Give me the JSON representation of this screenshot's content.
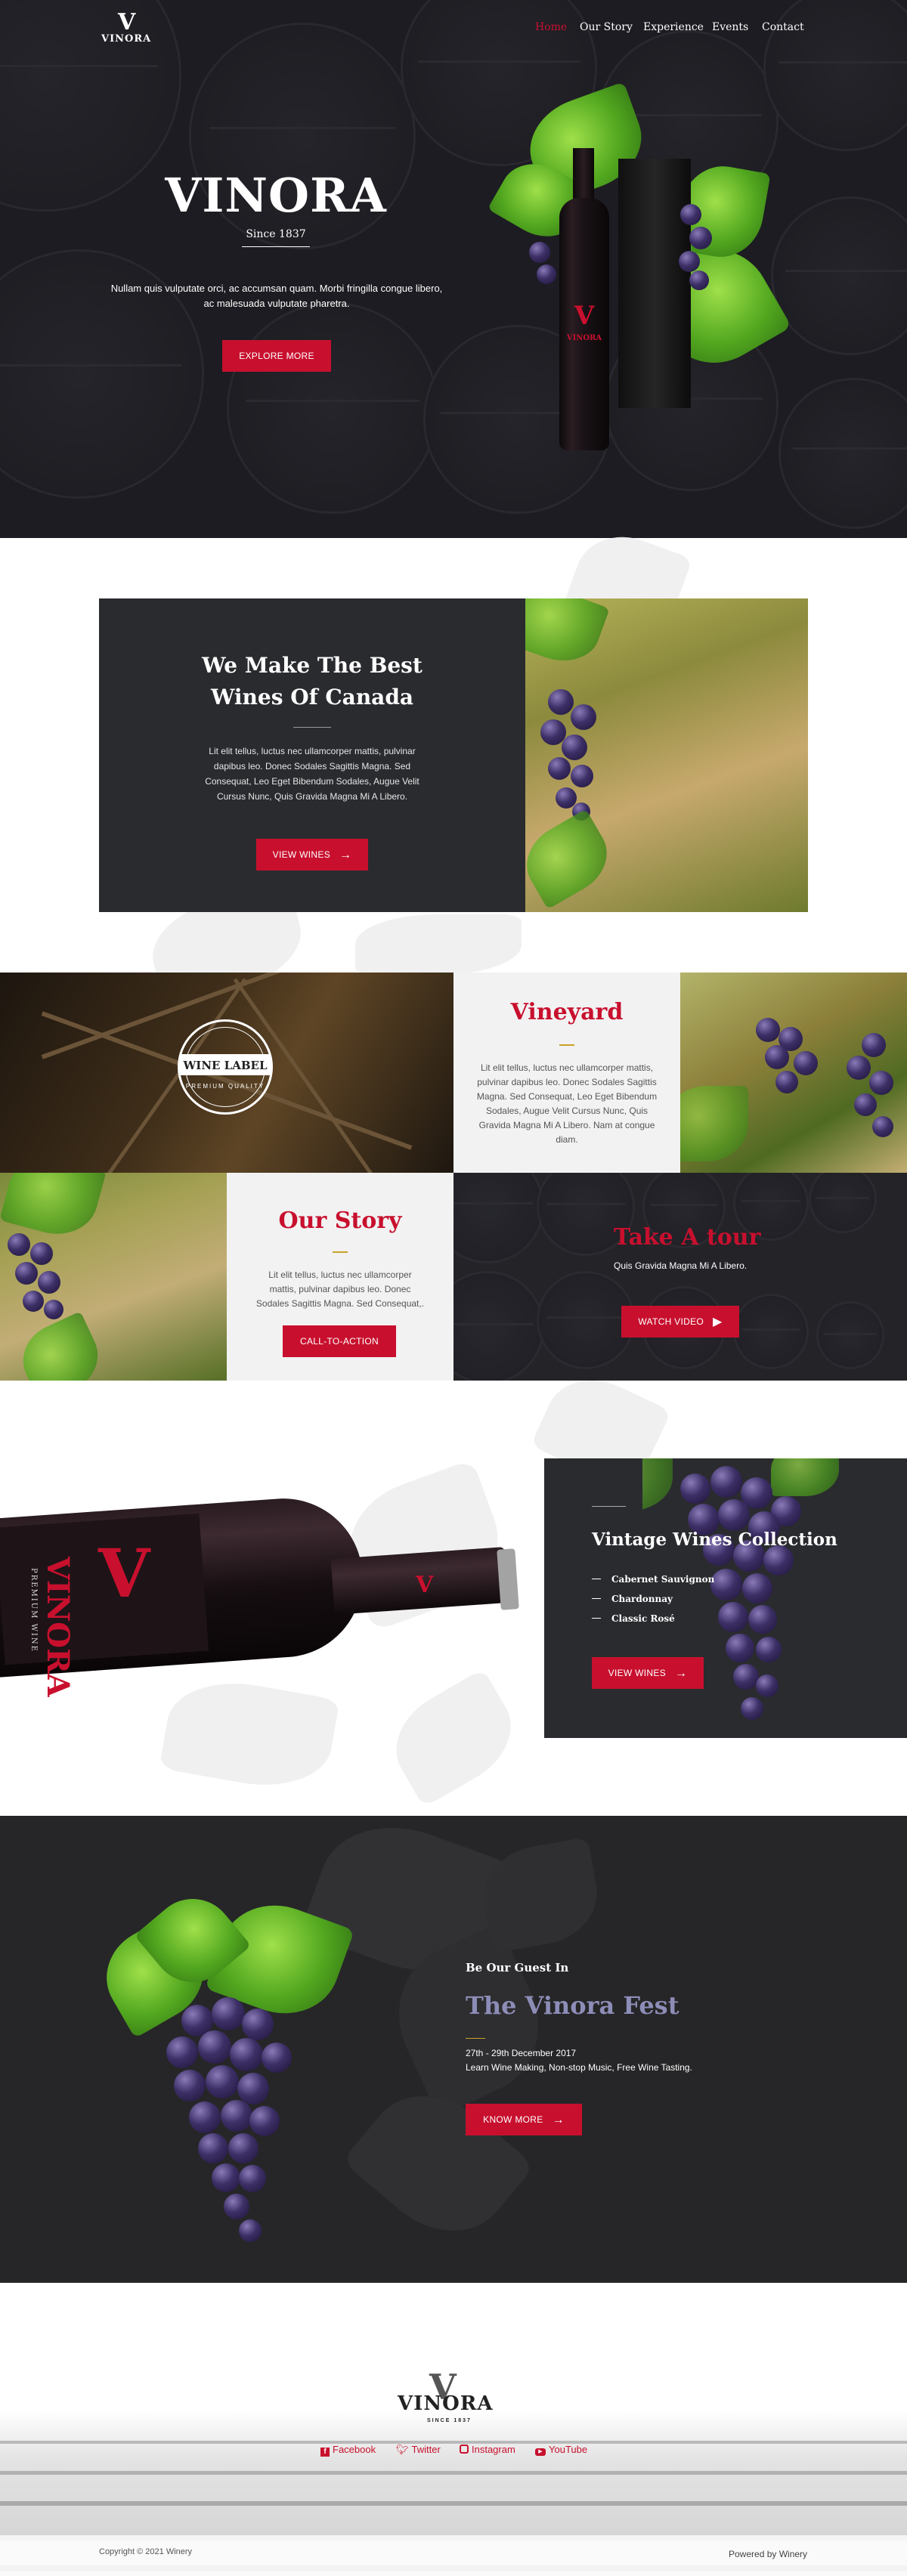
{
  "nav": {
    "logo_mark": "V",
    "logo_text": "VINORA",
    "items": [
      "Home",
      "Our Story",
      "Experience",
      "Events",
      "Contact"
    ]
  },
  "hero": {
    "title": "VINORA",
    "since": "Since 1837",
    "text": "Nullam quis vulputate orci, ac accumsan quam. Morbi fringilla congue libero, ac malesuada vulputate pharetra.",
    "button": "EXPLORE MORE"
  },
  "bottle_label": {
    "mark": "V",
    "name": "VINORA"
  },
  "intro": {
    "heading_line1": "We Make The Best",
    "heading_line2": "Wines Of Canada",
    "text": "Lit elit tellus, luctus nec ullamcorper mattis, pulvinar dapibus leo. Donec Sodales Sagittis Magna. Sed Consequat, Leo Eget Bibendum Sodales, Augue Velit Cursus Nunc, Quis Gravida Magna Mi A Libero.",
    "button": "VIEW WINES"
  },
  "wine_label_badge": {
    "text": "WINE LABEL",
    "sub": "PREMIUM QUALITY"
  },
  "vineyard": {
    "heading": "Vineyard",
    "text": "Lit elit tellus, luctus nec ullamcorper mattis, pulvinar dapibus leo. Donec Sodales Sagittis Magna. Sed Consequat, Leo Eget Bibendum Sodales, Augue Velit Cursus Nunc, Quis Gravida Magna Mi A Libero. Nam at congue diam."
  },
  "our_story": {
    "heading": "Our Story",
    "text": "Lit elit tellus, luctus nec ullamcorper mattis, pulvinar dapibus leo. Donec Sodales Sagittis Magna. Sed Consequat,.",
    "button": "CALL-TO-ACTION"
  },
  "tour": {
    "heading": "Take A tour",
    "text": "Quis Gravida Magna Mi A Libero.",
    "button": "WATCH VIDEO"
  },
  "collection": {
    "bottle_name": "VINORA",
    "bottle_sub": "PREMIUM WINE",
    "bottle_mark": "V",
    "heading": "Vintage Wines Collection",
    "items": [
      "Cabernet Sauvignon",
      "Chardonnay",
      "Classic Rosé"
    ],
    "button": "VIEW WINES"
  },
  "event": {
    "kicker": "Be Our Guest In",
    "heading": "The Vinora Fest",
    "date": "27th - 29th December 2017",
    "text": "Learn Wine Making, Non-stop Music, Free Wine Tasting.",
    "button": "KNOW MORE"
  },
  "footer": {
    "logo_mark": "V",
    "logo_text": "VINORA",
    "logo_since": "SINCE 1837",
    "social": [
      "Facebook",
      "Twitter",
      "Instagram",
      "YouTube"
    ],
    "copyright": "Copyright © 2021 Winery",
    "powered": "Powered by Winery"
  },
  "colors": {
    "accent": "#c8102e",
    "dark": "#2a2b2f",
    "event_heading": "#8d8db8"
  }
}
